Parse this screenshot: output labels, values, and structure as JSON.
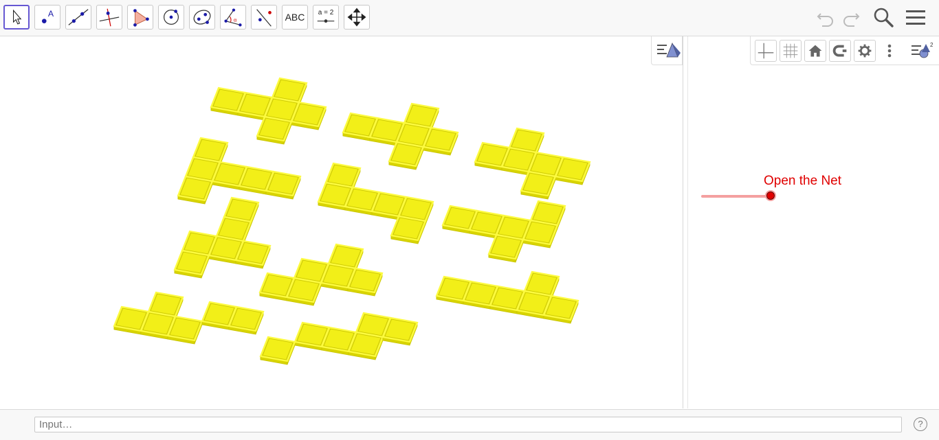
{
  "toolbar": {
    "tools": [
      {
        "name": "move-tool",
        "icon": "cursor-arrow-icon"
      },
      {
        "name": "point-tool",
        "icon": "point-a-icon"
      },
      {
        "name": "line-tool",
        "icon": "line-through-points-icon"
      },
      {
        "name": "perpendicular-line-tool",
        "icon": "perpendicular-line-icon"
      },
      {
        "name": "polygon-tool",
        "icon": "triangle-icon"
      },
      {
        "name": "circle-tool",
        "icon": "circle-center-icon"
      },
      {
        "name": "conic-tool",
        "icon": "ellipse-icon"
      },
      {
        "name": "angle-tool",
        "icon": "angle-icon"
      },
      {
        "name": "reflect-tool",
        "icon": "reflect-line-icon"
      },
      {
        "name": "text-tool",
        "label": "ABC"
      },
      {
        "name": "slider-tool",
        "label": "a = 2"
      },
      {
        "name": "move-graphics-tool",
        "icon": "move-arrows-icon"
      }
    ],
    "right_icons": [
      "undo-icon",
      "redo-icon",
      "search-icon",
      "menu-icon"
    ]
  },
  "graphics2d": {
    "slider_label": "Open the Net",
    "slider_value": 1.0,
    "slider_color": "#e00000"
  },
  "input_bar": {
    "placeholder": "Input…",
    "help_label": "?"
  },
  "colors": {
    "net_fill": "#f2ef18",
    "net_edge": "#c8c400",
    "accent": "#6557d2"
  }
}
